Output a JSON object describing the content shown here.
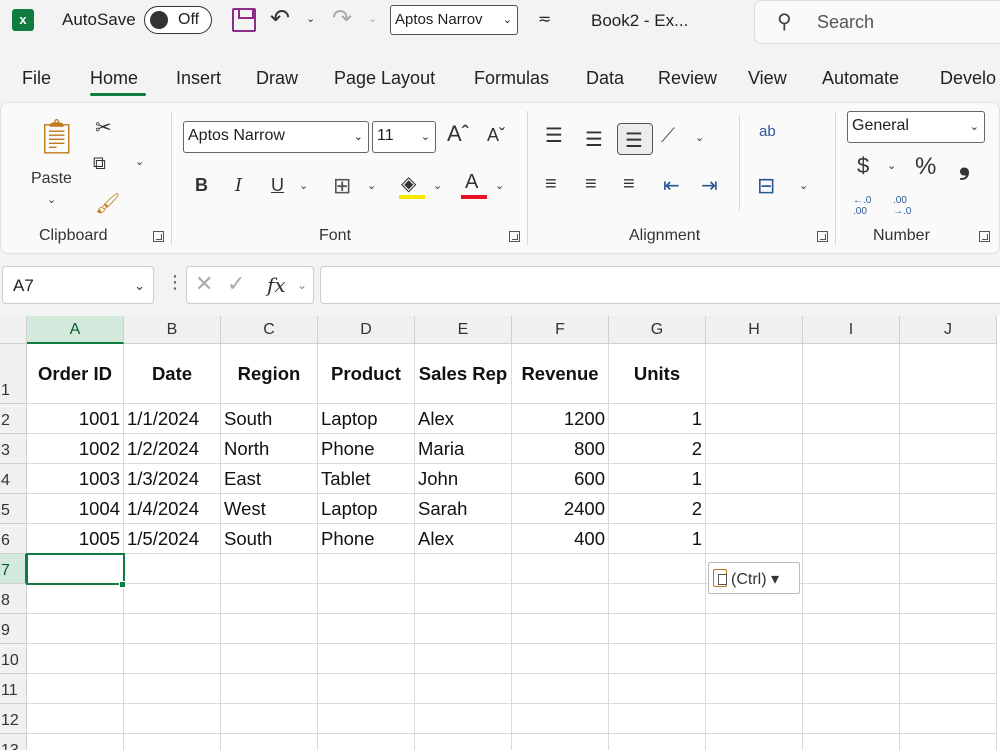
{
  "titlebar": {
    "logo_letter": "x",
    "autosave_label": "AutoSave",
    "autosave_state": "Off",
    "qat_font": "Aptos Narrov",
    "doc_title": "Book2  -  Ex...",
    "search_placeholder": "Search"
  },
  "tabs": [
    "File",
    "Home",
    "Insert",
    "Draw",
    "Page Layout",
    "Formulas",
    "Data",
    "Review",
    "View",
    "Automate",
    "Develo"
  ],
  "active_tab": "Home",
  "ribbon": {
    "clipboard": {
      "paste_label": "Paste",
      "group_label": "Clipboard"
    },
    "font": {
      "font_name": "Aptos Narrow",
      "font_size": "11",
      "bold": "B",
      "italic": "I",
      "underline": "U",
      "font_color_glyph": "A",
      "group_label": "Font",
      "highlight_color": "#f7e600",
      "font_color": "#e81123"
    },
    "alignment": {
      "group_label": "Alignment",
      "wrap_glyph": "ab"
    },
    "number": {
      "format": "General",
      "currency": "$",
      "percent": "%",
      "comma": "❟",
      "increase_decimal": "←.0 .00",
      "decrease_decimal": ".00 →.0",
      "group_label": "Number"
    }
  },
  "formula_bar": {
    "name_box": "A7",
    "fx": "fx",
    "formula": ""
  },
  "grid": {
    "columns": [
      "A",
      "B",
      "C",
      "D",
      "E",
      "F",
      "G",
      "H",
      "I",
      "J"
    ],
    "rows": [
      "1",
      "2",
      "3",
      "4",
      "5",
      "6",
      "7",
      "8",
      "9",
      "10",
      "11",
      "12",
      "13"
    ],
    "selected_column": "A",
    "selected_row": "7",
    "headers": [
      "Order ID",
      "Date",
      "Region",
      "Product",
      "Sales Rep",
      "Revenue",
      "Units"
    ],
    "data": [
      [
        "1001",
        "1/1/2024",
        "South",
        "Laptop",
        "Alex",
        "1200",
        "1"
      ],
      [
        "1002",
        "1/2/2024",
        "North",
        "Phone",
        "Maria",
        "800",
        "2"
      ],
      [
        "1003",
        "1/3/2024",
        "East",
        "Tablet",
        "John",
        "600",
        "1"
      ],
      [
        "1004",
        "1/4/2024",
        "West",
        "Laptop",
        "Sarah",
        "2400",
        "2"
      ],
      [
        "1005",
        "1/5/2024",
        "South",
        "Phone",
        "Alex",
        "400",
        "1"
      ]
    ]
  },
  "paste_options": "(Ctrl)",
  "colors": {
    "accent": "#107c41"
  }
}
